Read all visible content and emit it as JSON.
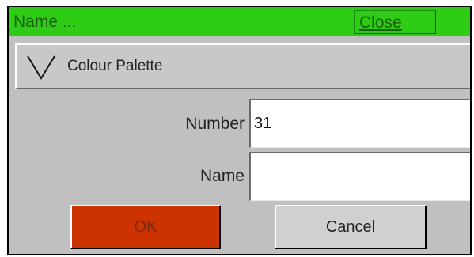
{
  "titlebar": {
    "title": "Name ...",
    "close_label": "Close",
    "color": "#2ecc14"
  },
  "section": {
    "label": "Colour Palette",
    "icon": "chevron-down-icon"
  },
  "fields": {
    "number": {
      "label": "Number",
      "value": "31"
    },
    "name": {
      "label": "Name",
      "value": ""
    }
  },
  "buttons": {
    "ok_label": "OK",
    "ok_color": "#cc3300",
    "cancel_label": "Cancel"
  }
}
